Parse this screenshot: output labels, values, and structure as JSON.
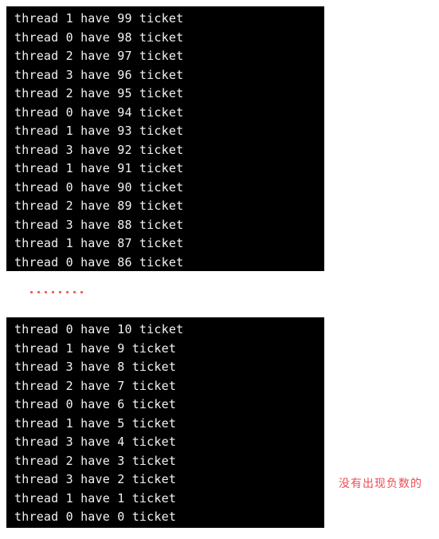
{
  "background_color": "#ffffff",
  "terminal": {
    "background_color": "#000000",
    "text_color": "#f2f2f2"
  },
  "blocks": [
    {
      "name": "first-output-block",
      "lines": [
        "thread 1 have 99 ticket",
        "thread 0 have 98 ticket",
        "thread 2 have 97 ticket",
        "thread 3 have 96 ticket",
        "thread 2 have 95 ticket",
        "thread 0 have 94 ticket",
        "thread 1 have 93 ticket",
        "thread 3 have 92 ticket",
        "thread 1 have 91 ticket",
        "thread 0 have 90 ticket",
        "thread 2 have 89 ticket",
        "thread 3 have 88 ticket",
        "thread 1 have 87 ticket",
        "thread 0 have 86 ticket"
      ]
    },
    {
      "name": "second-output-block",
      "lines": [
        "thread 0 have 10 ticket",
        "thread 1 have 9 ticket",
        "thread 3 have 8 ticket",
        "thread 2 have 7 ticket",
        "thread 0 have 6 ticket",
        "thread 1 have 5 ticket",
        "thread 3 have 4 ticket",
        "thread 2 have 3 ticket",
        "thread 3 have 2 ticket",
        "thread 1 have 1 ticket",
        "thread 0 have 0 ticket"
      ]
    }
  ],
  "separator": {
    "style": "dots",
    "dot_count": 8,
    "color": "#f4665e"
  },
  "annotation": {
    "text": "没有出现负数的",
    "color": "#ee4b54"
  }
}
